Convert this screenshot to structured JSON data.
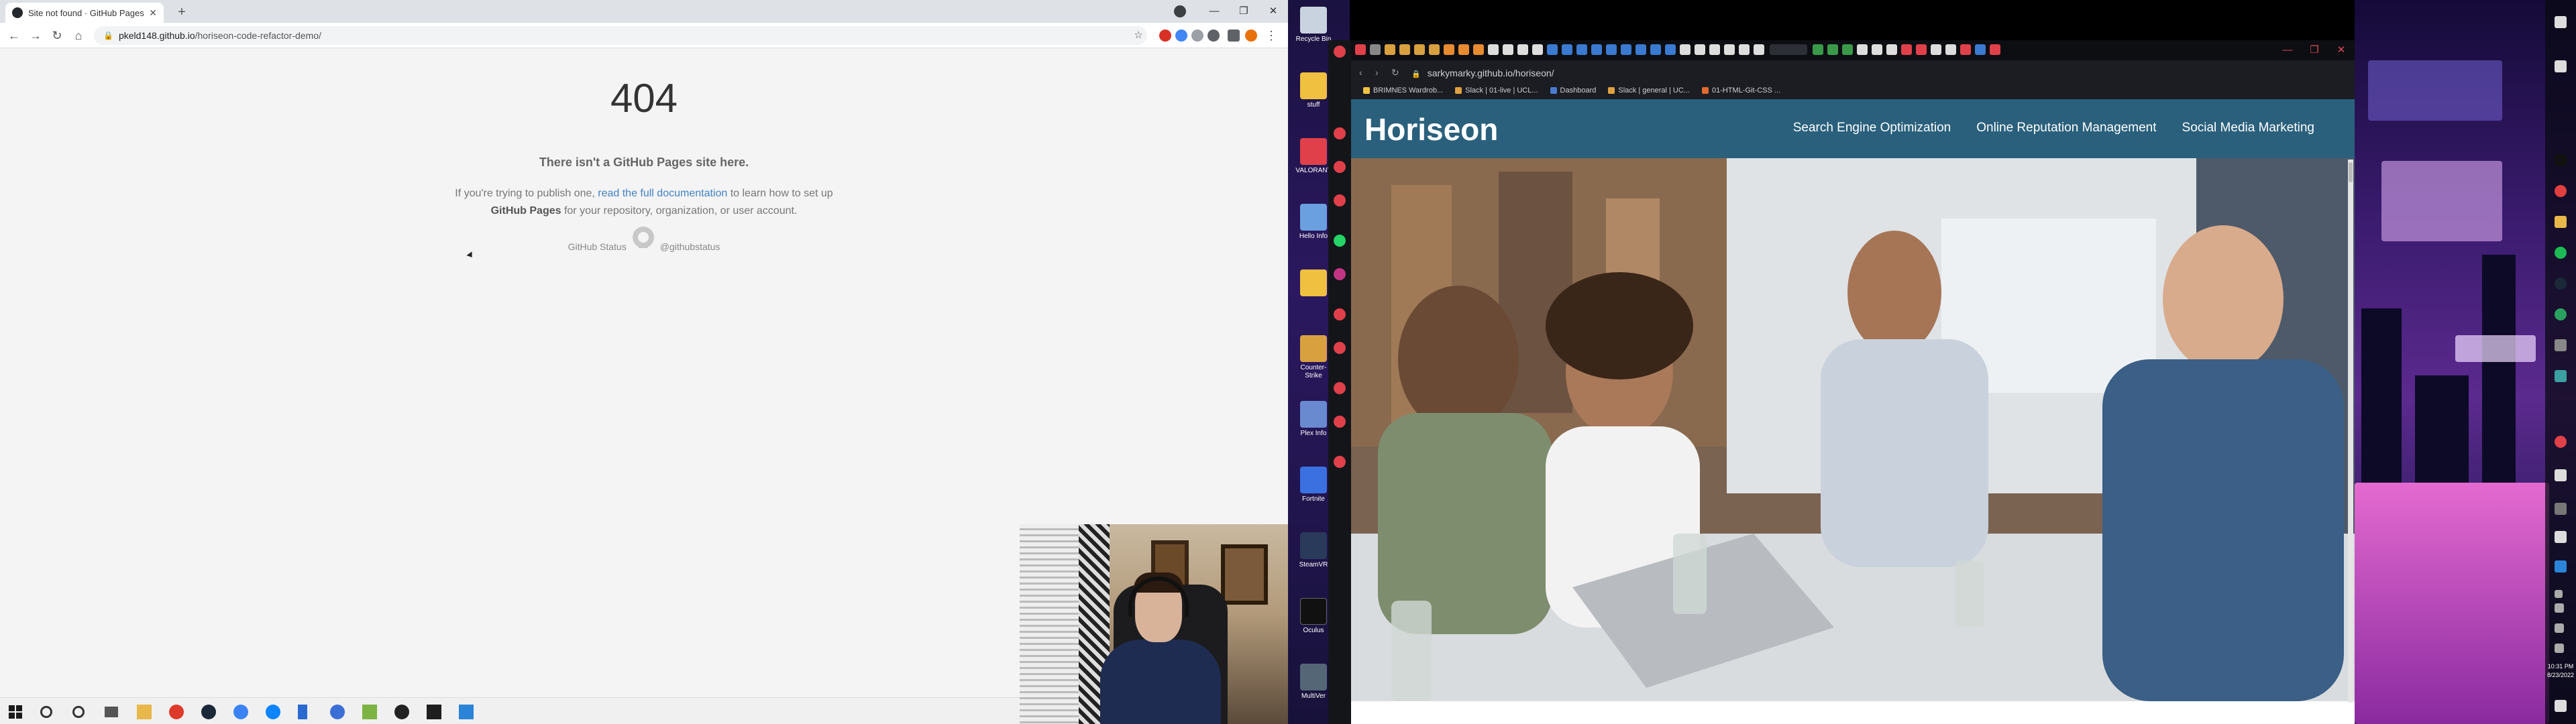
{
  "left_browser": {
    "tab_title": "Site not found · GitHub Pages",
    "new_tab_label": "+",
    "url_host": "pkeld148.github.io",
    "url_path": "/horiseon-code-refactor-demo/",
    "window_controls": [
      "—",
      "❐",
      "✕"
    ]
  },
  "gh404": {
    "code": "404",
    "lead": "There isn't a GitHub Pages site here.",
    "body_1": "If you're trying to publish one, ",
    "body_link": "read the full documentation",
    "body_2": " to learn how to set up",
    "body_strong": "GitHub Pages",
    "body_3": " for your repository, organization, or user account.",
    "status_link": "GitHub Status",
    "separator": "—",
    "twitter_link": "@githubstatus"
  },
  "desktop_icons": [
    {
      "label": "Recycle Bin",
      "color": "#c9d3e0"
    },
    {
      "label": "stuff",
      "color": "#f0c040"
    },
    {
      "label": "VALORANT",
      "color": "#e0404a"
    },
    {
      "label": "Hello Info",
      "color": "#6aa0e0"
    },
    {
      "label": "",
      "color": "#f0c040"
    },
    {
      "label": "Counter-Strike",
      "color": "#d9a040"
    },
    {
      "label": "Plex Info",
      "color": "#6a8ad0"
    },
    {
      "label": "Fortnite",
      "color": "#3a70e0"
    },
    {
      "label": "SteamVR",
      "color": "#2a3a5a"
    },
    {
      "label": "Oculus",
      "color": "#111111"
    },
    {
      "label": "MultiVer",
      "color": "#556677"
    }
  ],
  "opera": {
    "url_host": "sarkymarky.github.io",
    "url_path": "/horiseon/",
    "bookmarks": [
      {
        "label": "BRIMNES Wardrob...",
        "color": "#f0c040"
      },
      {
        "label": "Slack | 01-live | UCL...",
        "color": "#e0a040"
      },
      {
        "label": "Dashboard",
        "color": "#4a7ad0"
      },
      {
        "label": "Slack | general | UC...",
        "color": "#e0a040"
      },
      {
        "label": "01-HTML-Git-CSS ...",
        "color": "#e06a30"
      }
    ],
    "window_controls": [
      "—",
      "❐",
      "✕"
    ]
  },
  "horiseon": {
    "logo": "Horiseon",
    "nav": [
      "Search Engine Optimization",
      "Online Reputation Management",
      "Social Media Marketing"
    ]
  },
  "clock": {
    "time": "10:31 PM",
    "date": "8/23/2022"
  }
}
